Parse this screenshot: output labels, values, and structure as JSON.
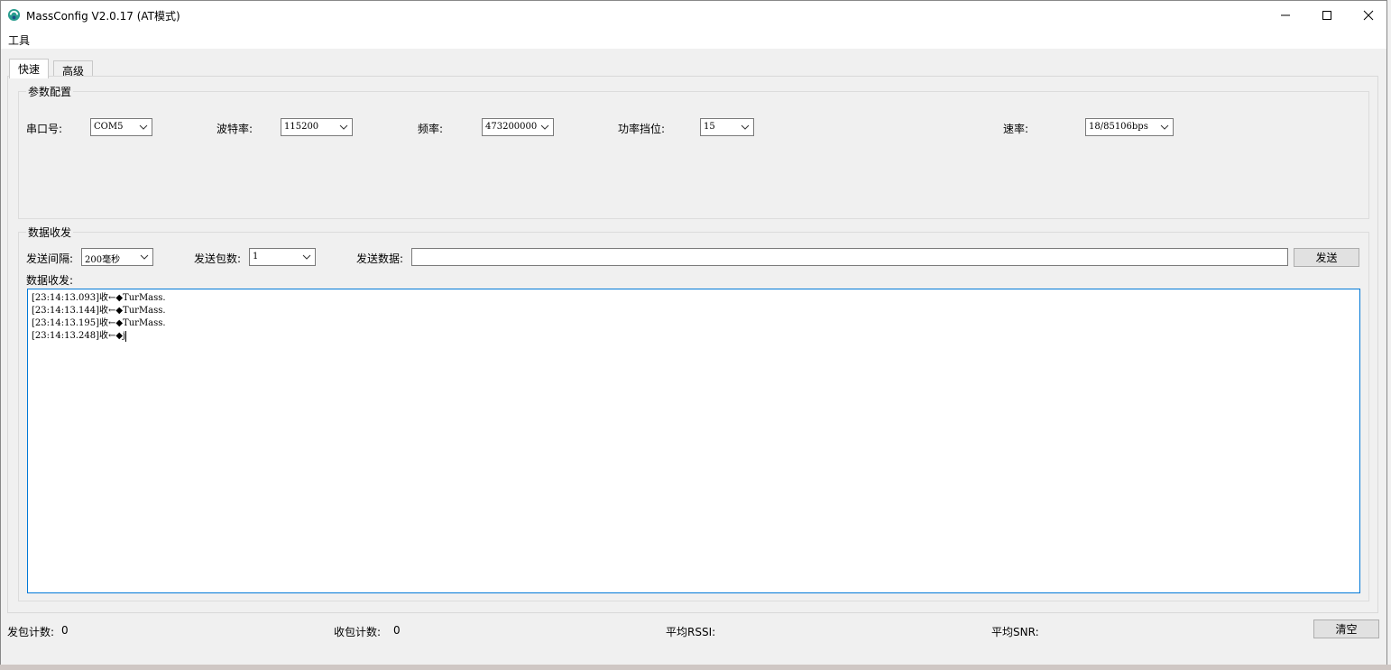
{
  "window": {
    "title": "MassConfig V2.0.17 (AT模式)",
    "controls": [
      "minimize-icon",
      "maximize-icon",
      "close-icon"
    ]
  },
  "menu": {
    "tools": "工具"
  },
  "tabs": [
    {
      "label": "快速",
      "active": true
    },
    {
      "label": "高级",
      "active": false
    }
  ],
  "params": {
    "legend": "参数配置",
    "port_label": "串口号:",
    "port_value": "COM5",
    "baud_label": "波特率:",
    "baud_value": "115200",
    "freq_label": "频率:",
    "freq_value": "473200000",
    "power_label": "功率挡位:",
    "power_value": "15",
    "rate_label": "速率:",
    "rate_value": "18/85106bps"
  },
  "data": {
    "legend": "数据收发",
    "interval_label": "发送间隔:",
    "interval_value": "200毫秒",
    "count_label": "发送包数:",
    "count_value": "1",
    "send_data_label": "发送数据:",
    "send_data_value": "",
    "send_button": "发送",
    "log_label": "数据收发:",
    "log": [
      "[23:14:13.093]收←◆TurMass.",
      "[23:14:13.144]收←◆TurMass.",
      "[23:14:13.195]收←◆TurMass.",
      "[23:14:13.248]收←◆j"
    ]
  },
  "status": {
    "sent_label": "发包计数:",
    "sent_value": "0",
    "recv_label": "收包计数:",
    "recv_value": "0",
    "rssi_label": "平均RSSI:",
    "snr_label": "平均SNR:",
    "clear_button": "清空"
  },
  "colors": {
    "accent_border": "#0078d7",
    "window_bg": "#f0f0f0"
  }
}
